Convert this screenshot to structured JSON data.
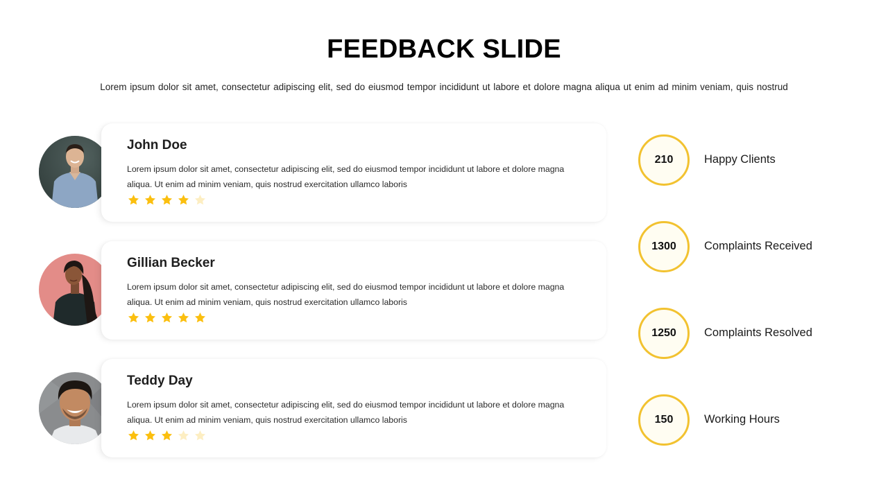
{
  "header": {
    "title": "FEEDBACK SLIDE",
    "subtitle": "Lorem ipsum dolor sit amet, consectetur adipiscing elit, sed do eiusmod tempor incididunt ut labore et dolore magna aliqua ut enim ad minim veniam, quis nostrud"
  },
  "colors": {
    "accent": "#f2c230",
    "star_filled": "#fbbf0f",
    "star_empty": "#fdeec2"
  },
  "testimonials": [
    {
      "name": "John Doe",
      "text": "Lorem ipsum dolor sit amet, consectetur adipiscing elit, sed do eiusmod tempor incididunt ut labore et dolore magna aliqua. Ut enim ad minim veniam, quis nostrud exercitation ullamco laboris",
      "rating": 4,
      "max_rating": 5,
      "avatar": "man-blue-shirt-photo"
    },
    {
      "name": "Gillian Becker",
      "text": "Lorem ipsum dolor sit amet, consectetur adipiscing elit, sed do eiusmod tempor incididunt ut labore et dolore magna aliqua. Ut enim ad minim veniam, quis nostrud exercitation ullamco laboris",
      "rating": 5,
      "max_rating": 5,
      "avatar": "woman-pink-background-photo"
    },
    {
      "name": "Teddy Day",
      "text": "Lorem ipsum dolor sit amet, consectetur adipiscing elit, sed do eiusmod tempor incididunt ut labore et dolore magna aliqua. Ut enim ad minim veniam, quis nostrud exercitation ullamco laboris",
      "rating": 3,
      "max_rating": 5,
      "avatar": "smiling-man-photo"
    }
  ],
  "stats": [
    {
      "value": "210",
      "label": "Happy Clients"
    },
    {
      "value": "1300",
      "label": "Complaints Received"
    },
    {
      "value": "1250",
      "label": "Complaints Resolved"
    },
    {
      "value": "150",
      "label": "Working Hours"
    }
  ]
}
